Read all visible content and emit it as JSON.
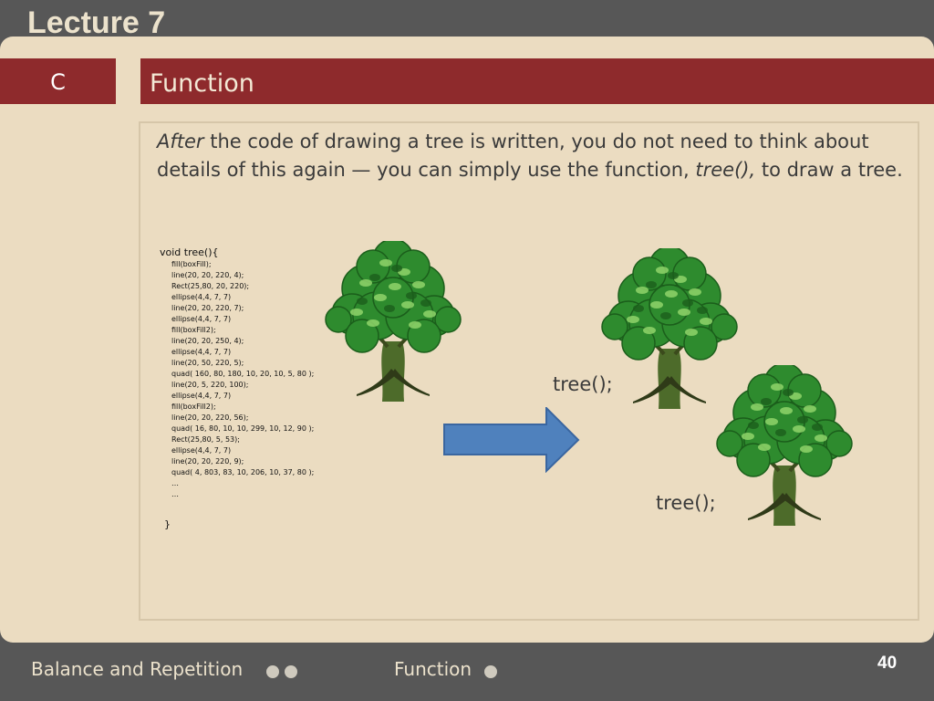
{
  "header": {
    "lecture": "Lecture 7"
  },
  "band": {
    "section": "C",
    "title": "Function"
  },
  "intro": {
    "after": "After",
    "text1": " the code of drawing a tree is written, you do not need to think about details of this again — you can simply use the function, ",
    "func": "tree(),",
    "text2": " to draw a tree."
  },
  "code": {
    "head": "void tree(){",
    "lines": [
      "fill(boxFill);",
      "line(20, 20, 220, 4);",
      "Rect(25,80, 20, 220);",
      "ellipse(4,4, 7, 7)",
      "line(20, 20, 220, 7);",
      "ellipse(4,4, 7, 7)",
      "fill(boxFill2);",
      "line(20, 20, 250, 4);",
      "ellipse(4,4, 7, 7)",
      "line(20, 50, 220, 5);",
      "quad( 160, 80, 180, 10, 20, 10, 5, 80 );",
      "line(20, 5, 220, 100);",
      "ellipse(4,4, 7, 7)",
      "fill(boxFill2);",
      "line(20, 20, 220, 56);",
      "quad( 16, 80, 10, 10, 299, 10, 12, 90 );",
      "Rect(25,80, 5, 53);",
      "ellipse(4,4, 7, 7)",
      "line(20, 20, 220, 9);",
      "quad( 4, 803, 83, 10, 206, 10, 37, 80 );",
      "…",
      "…"
    ],
    "close": "}"
  },
  "calls": {
    "first": "tree();",
    "second": "tree();"
  },
  "footer": {
    "left": "Balance and Repetition",
    "center": "Function",
    "page": "40"
  },
  "colors": {
    "band": "#8e2a2c",
    "slide": "#ebdcc1",
    "arrow": "#4f81bd",
    "leaf": "#2e8b2e",
    "trunk": "#4d6b2a"
  }
}
